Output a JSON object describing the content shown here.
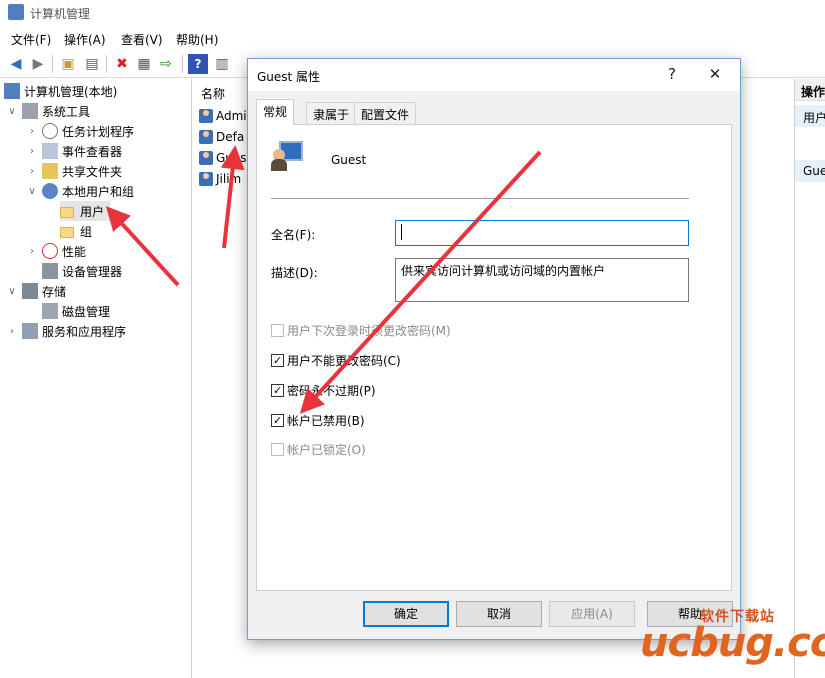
{
  "window": {
    "title": "计算机管理",
    "menu": [
      "文件(F)",
      "操作(A)",
      "查看(V)",
      "帮助(H)"
    ]
  },
  "tree": {
    "items": [
      {
        "label": "计算机管理(本地)"
      },
      {
        "label": "系统工具"
      },
      {
        "label": "任务计划程序"
      },
      {
        "label": "事件查看器"
      },
      {
        "label": "共享文件夹"
      },
      {
        "label": "本地用户和组"
      },
      {
        "label": "用户"
      },
      {
        "label": "组"
      },
      {
        "label": "性能"
      },
      {
        "label": "设备管理器"
      },
      {
        "label": "存储"
      },
      {
        "label": "磁盘管理"
      },
      {
        "label": "服务和应用程序"
      }
    ]
  },
  "list": {
    "header": "名称",
    "rows": [
      "Admi",
      "Defa",
      "Gues",
      "Jilim"
    ]
  },
  "actions": {
    "header": "操作",
    "items": [
      "用户",
      "Gue"
    ]
  },
  "dialog": {
    "title": "Guest 属性",
    "help_glyph": "?",
    "close_glyph": "✕",
    "tabs": [
      "常规",
      "隶属于",
      "配置文件"
    ],
    "username": "Guest",
    "fullname_label": "全名(F):",
    "fullname_value": "",
    "description_label": "描述(D):",
    "description_value": "供来宾访问计算机或访问域的内置帐户",
    "checkboxes": [
      {
        "label": "用户下次登录时须更改密码(M)",
        "checked": false,
        "enabled": false
      },
      {
        "label": "用户不能更改密码(C)",
        "checked": true,
        "enabled": true
      },
      {
        "label": "密码永不过期(P)",
        "checked": true,
        "enabled": true
      },
      {
        "label": "帐户已禁用(B)",
        "checked": true,
        "enabled": true
      },
      {
        "label": "帐户已锁定(O)",
        "checked": false,
        "enabled": false
      }
    ],
    "buttons": {
      "ok": "确定",
      "cancel": "取消",
      "apply": "应用(A)",
      "help": "帮助"
    }
  },
  "watermark": {
    "cn": "软件下载站",
    "en": "ucbug.cc"
  },
  "colors": {
    "accent": "#0078d7",
    "arrow": "#e8333a"
  }
}
